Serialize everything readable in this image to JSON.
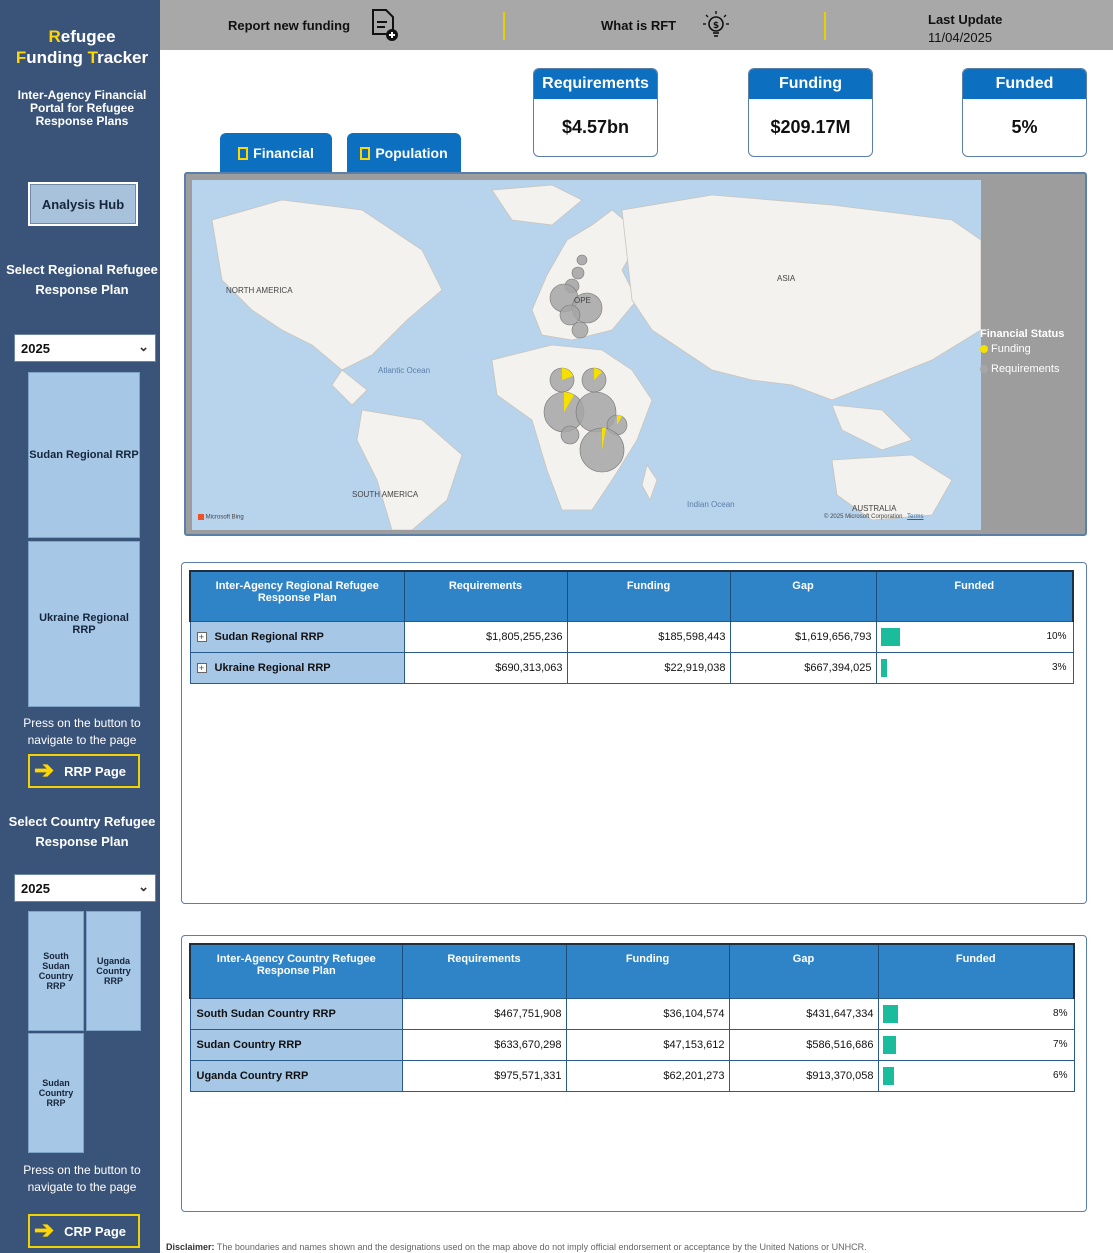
{
  "app": {
    "brand_line1_first": "R",
    "brand_line1_rest": "efugee",
    "brand_line2_first": "F",
    "brand_line2_mid": "unding ",
    "brand_line2_t": "T",
    "brand_line2_rest": "racker",
    "tagline": "Inter-Agency Financial Portal for Refugee Response Plans",
    "accent_color": "#ffd600",
    "sidebar_color": "#3a5378",
    "primary_blue": "#0d6fbf"
  },
  "sidebar": {
    "analysis_hub": "Analysis Hub",
    "regional_heading": "Select Regional Refugee Response Plan",
    "regional_year": "2025",
    "regional_tiles": [
      "Sudan Regional RRP",
      "Ukraine Regional RRP"
    ],
    "press_text": "Press on the button to navigate to the page",
    "rrp_button": "RRP Page",
    "country_heading": "Select Country Refugee Response Plan",
    "country_year": "2025",
    "country_tiles": [
      "South Sudan Country RRP",
      "Uganda Country RRP",
      "Sudan Country RRP"
    ],
    "press_text2": "Press on the button to navigate to the page",
    "crp_button": "CRP Page"
  },
  "topbar": {
    "report_funding": "Report new funding",
    "what_is_rft": "What is RFT",
    "last_update_label": "Last Update",
    "last_update_date": "11/04/2025"
  },
  "kpis": {
    "requirements_label": "Requirements",
    "requirements_value": "$4.57bn",
    "funding_label": "Funding",
    "funding_value": "$209.17M",
    "funded_label": "Funded",
    "funded_value": "5%"
  },
  "tabs": {
    "financial": "Financial",
    "population": "Population"
  },
  "map": {
    "labels": {
      "north_america": "NORTH AMERICA",
      "south_america": "SOUTH AMERICA",
      "asia": "ASIA",
      "europe": "OPE",
      "australia": "AUSTRALIA",
      "atlantic": "Atlantic Ocean",
      "indian": "Indian Ocean",
      "attribution": "© 2025 Microsoft Corporation",
      "terms": "Terms",
      "bing": "Microsoft Bing"
    },
    "legend_title": "Financial Status",
    "legend_funding": "Funding",
    "legend_requirements": "Requirements",
    "funding_color": "#f5e000",
    "requirements_color": "#a6a6a6"
  },
  "regional_table": {
    "headers": [
      "Inter-Agency Regional Refugee Response Plan",
      "Requirements",
      "Funding",
      "Gap",
      "Funded"
    ],
    "rows": [
      {
        "name": "Sudan Regional RRP",
        "requirements": "$1,805,255,236",
        "funding": "$185,598,443",
        "gap": "$1,619,656,793",
        "funded": "10%",
        "funded_value": 10
      },
      {
        "name": "Ukraine Regional RRP",
        "requirements": "$690,313,063",
        "funding": "$22,919,038",
        "gap": "$667,394,025",
        "funded": "3%",
        "funded_value": 3
      }
    ]
  },
  "country_table": {
    "headers": [
      "Inter-Agency Country Refugee Response Plan",
      "Requirements",
      "Funding",
      "Gap",
      "Funded"
    ],
    "rows": [
      {
        "name": "South Sudan Country RRP",
        "requirements": "$467,751,908",
        "funding": "$36,104,574",
        "gap": "$431,647,334",
        "funded": "8%",
        "funded_value": 8
      },
      {
        "name": "Sudan Country RRP",
        "requirements": "$633,670,298",
        "funding": "$47,153,612",
        "gap": "$586,516,686",
        "funded": "7%",
        "funded_value": 7
      },
      {
        "name": "Uganda Country RRP",
        "requirements": "$975,571,331",
        "funding": "$62,201,273",
        "gap": "$913,370,058",
        "funded": "6%",
        "funded_value": 6
      }
    ]
  },
  "footer": {
    "disclaimer_label": "Disclaimer:",
    "disclaimer_text": " The boundaries and names shown and the designations used on the map above do not imply official endorsement or acceptance by the United Nations or UNHCR."
  }
}
